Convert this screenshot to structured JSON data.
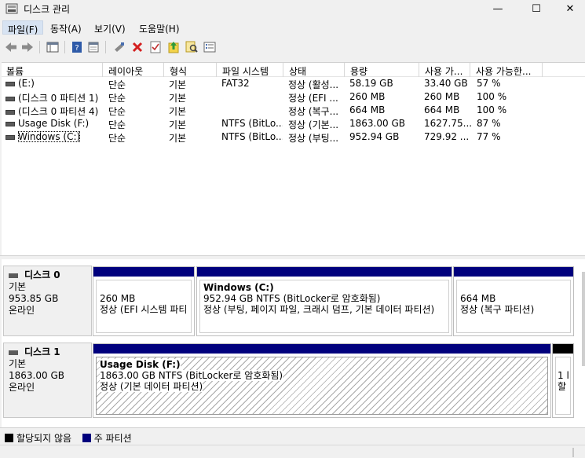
{
  "window": {
    "title": "디스크 관리",
    "minimize_glyph": "—",
    "maximize_glyph": "☐",
    "close_glyph": "✕"
  },
  "menu": [
    {
      "label": "파일(F)"
    },
    {
      "label": "동작(A)"
    },
    {
      "label": "보기(V)"
    },
    {
      "label": "도움말(H)"
    }
  ],
  "toolbar": {
    "icons": [
      "back-icon",
      "forward-icon",
      "console-tree-icon",
      "help-icon",
      "refresh-icon",
      "delete-icon",
      "properties-icon",
      "move-up-icon",
      "find-icon",
      "list-view-icon"
    ]
  },
  "volume_list": {
    "headers": [
      "볼륨",
      "레이아웃",
      "형식",
      "파일 시스템",
      "상태",
      "용량",
      "사용 가...",
      "사용 가능한..."
    ],
    "rows": [
      {
        "name": "(E:)",
        "layout": "단순",
        "type": "기본",
        "fs": "FAT32",
        "status": "정상 (활성...",
        "capacity": "58.19 GB",
        "free": "33.40 GB",
        "pct": "57 %"
      },
      {
        "name": "(디스크 0 파티션 1)",
        "layout": "단순",
        "type": "기본",
        "fs": "",
        "status": "정상 (EFI ...",
        "capacity": "260 MB",
        "free": "260 MB",
        "pct": "100 %"
      },
      {
        "name": "(디스크 0 파티션 4)",
        "layout": "단순",
        "type": "기본",
        "fs": "",
        "status": "정상 (복구...",
        "capacity": "664 MB",
        "free": "664 MB",
        "pct": "100 %"
      },
      {
        "name": "Usage Disk (F:)",
        "layout": "단순",
        "type": "기본",
        "fs": "NTFS (BitLo...",
        "status": "정상 (기본...",
        "capacity": "1863.00 GB",
        "free": "1627.75...",
        "pct": "87 %"
      },
      {
        "name": "Windows (C:)",
        "layout": "단순",
        "type": "기본",
        "fs": "NTFS (BitLo...",
        "status": "정상 (부팅...",
        "capacity": "952.94 GB",
        "free": "729.92 ...",
        "pct": "77 %"
      }
    ]
  },
  "disks": [
    {
      "name": "디스크 0",
      "kind": "기본",
      "size": "953.85 GB",
      "state": "온라인",
      "partitions": [
        {
          "title": "",
          "size": "260 MB",
          "status": "정상 (EFI 시스템 파티"
        },
        {
          "title": "Windows  (C:)",
          "size": "952.94 GB NTFS (BitLocker로 암호화됨)",
          "status": "정상 (부팅, 페이지 파일, 크래시 덤프, 기본 데이터 파티션)"
        },
        {
          "title": "",
          "size": "664 MB",
          "status": "정상 (복구 파티션)"
        }
      ]
    },
    {
      "name": "디스크 1",
      "kind": "기본",
      "size": "1863.00 GB",
      "state": "온라인",
      "partitions": [
        {
          "title": "Usage Disk  (F:)",
          "size": "1863.00 GB NTFS (BitLocker로 암호화됨)",
          "status": "정상 (기본 데이터 파티션)"
        },
        {
          "title": "",
          "size": "1 l",
          "status": "할"
        }
      ]
    }
  ],
  "legend": {
    "unallocated": "할당되지 않음",
    "primary": "주 파티션",
    "unallocated_color": "#000000",
    "primary_color": "#00007d"
  }
}
